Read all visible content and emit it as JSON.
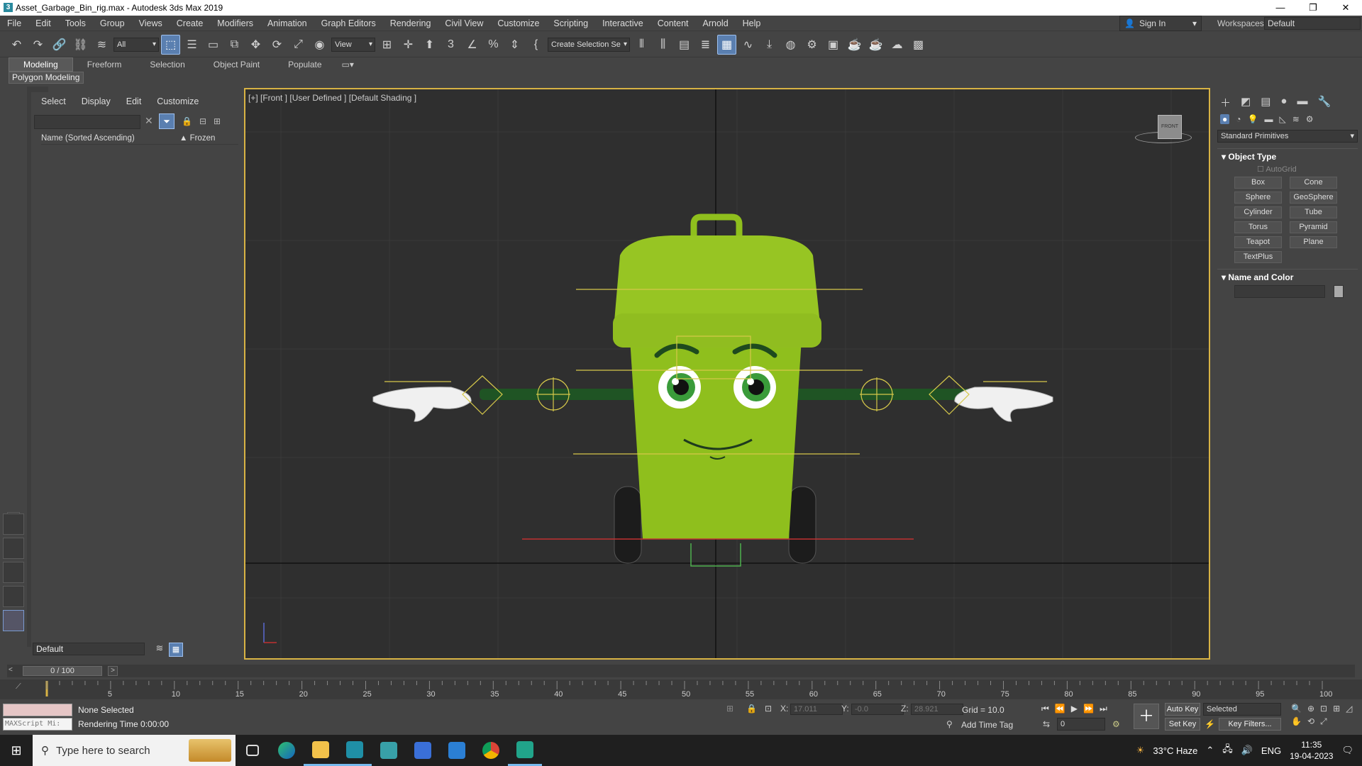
{
  "window": {
    "title": "Asset_Garbage_Bin_rig.max - Autodesk 3ds Max 2019",
    "icon_letter": "3"
  },
  "menu": [
    "File",
    "Edit",
    "Tools",
    "Group",
    "Views",
    "Create",
    "Modifiers",
    "Animation",
    "Graph Editors",
    "Rendering",
    "Civil View",
    "Customize",
    "Scripting",
    "Interactive",
    "Content",
    "Arnold",
    "Help"
  ],
  "account": {
    "sign_in": "Sign In",
    "workspaces_label": "Workspaces:",
    "workspace_value": "Default"
  },
  "toolbar": {
    "filter_value": "All",
    "refcoord_value": "View",
    "named_selection_placeholder": "Create Selection Se"
  },
  "ribbon": {
    "tabs": [
      "Modeling",
      "Freeform",
      "Selection",
      "Object Paint",
      "Populate"
    ],
    "active_subpanel": "Polygon Modeling"
  },
  "scene_explorer": {
    "menu": [
      "Select",
      "Display",
      "Edit",
      "Customize"
    ],
    "columns": {
      "name": "Name (Sorted Ascending)",
      "frozen": "▲ Frozen"
    },
    "layer": "Default"
  },
  "viewport": {
    "label": "[+] [Front ] [User Defined ] [Default Shading ]",
    "viewcube_face": "FRONT"
  },
  "command_panel": {
    "category": "Standard Primitives",
    "object_type_title": "Object Type",
    "autogrid": "AutoGrid",
    "primitives": [
      "Box",
      "Cone",
      "Sphere",
      "GeoSphere",
      "Cylinder",
      "Tube",
      "Torus",
      "Pyramid",
      "Teapot",
      "Plane",
      "TextPlus"
    ],
    "name_color_title": "Name and Color"
  },
  "time": {
    "slider": "0 / 100",
    "ticks": [
      "0",
      "5",
      "10",
      "15",
      "20",
      "25",
      "30",
      "35",
      "40",
      "45",
      "50",
      "55",
      "60",
      "65",
      "70",
      "75",
      "80",
      "85",
      "90",
      "95",
      "100"
    ],
    "current_frame": "0"
  },
  "status": {
    "selection": "None Selected",
    "rendering_time": "Rendering Time  0:00:00",
    "maxscript": "MAXScript Mi:",
    "x_label": "X:",
    "x_value": "17.011",
    "y_label": "Y:",
    "y_value": "-0.0",
    "z_label": "Z:",
    "z_value": "28.921",
    "grid": "Grid = 10.0",
    "add_time_tag": "Add Time Tag",
    "auto_key": "Auto Key",
    "set_key": "Set Key",
    "selected_set": "Selected",
    "key_filters": "Key Filters..."
  },
  "taskbar": {
    "search_placeholder": "Type here to search",
    "weather": "33°C  Haze",
    "language": "ENG",
    "time": "11:35",
    "date": "19-04-2023"
  },
  "colors": {
    "bin": "#8fbf1d",
    "arms": "#2a5a2a",
    "viewport_border": "#d8b344",
    "active": "#5a7fb0"
  }
}
